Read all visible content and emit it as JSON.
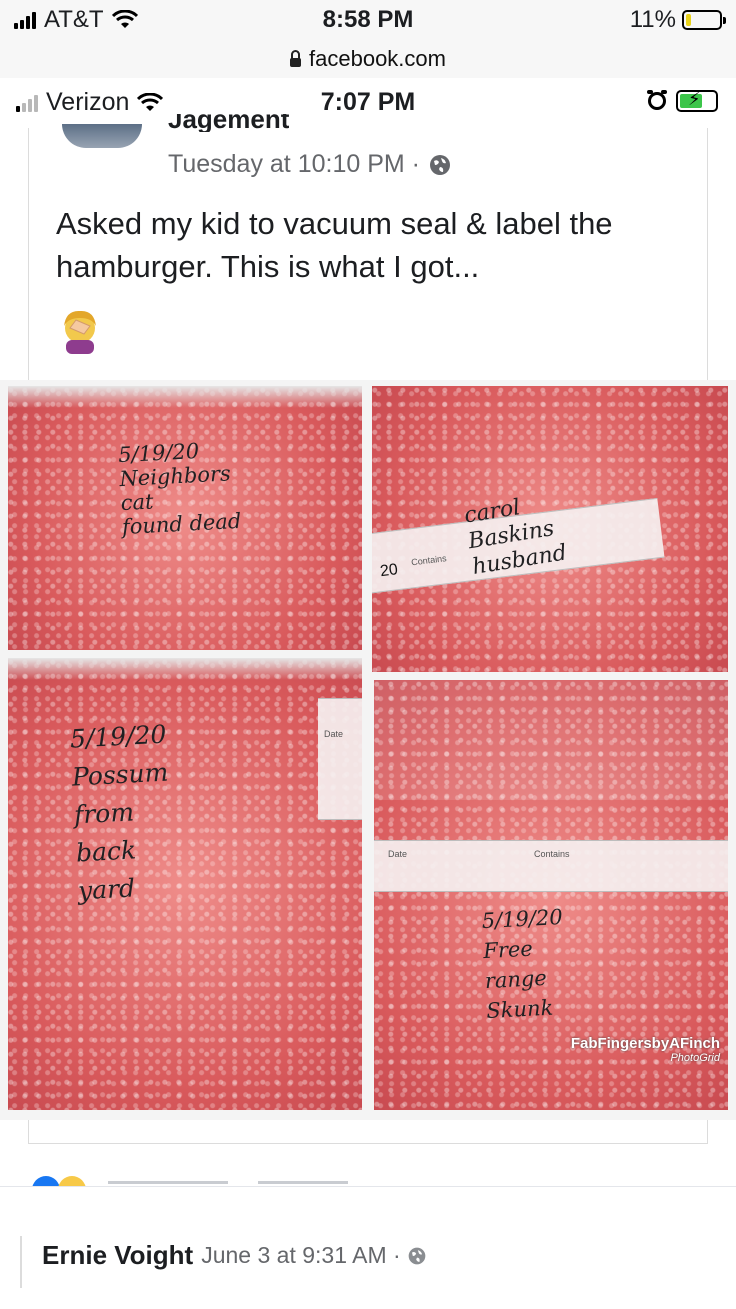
{
  "outer_status": {
    "carrier": "AT&T",
    "time": "8:58 PM",
    "battery_percent": "11%",
    "url": "facebook.com",
    "battery_level": 0.11
  },
  "inner_status": {
    "carrier": "Verizon",
    "time": "7:07 PM",
    "battery_level": 0.55,
    "battery_color": "#3cc54a"
  },
  "post": {
    "author_partial": "Jagement",
    "timestamp": "Tuesday at 10:10 PM ·",
    "privacy_icon": "globe-icon",
    "text": "Asked my kid to vacuum seal & label the hamburger. This is what I got...",
    "emoji": "face-palm-emoji",
    "photos": [
      {
        "label": "5/19/20\nNeighbors\ncat\nfound dead"
      },
      {
        "label": "carol\nBaskins\nhusband",
        "strip_text": "Contains",
        "strip_date": "20"
      },
      {
        "label": "5/19/20\nPossum\nfrom\nback\nyard",
        "strip_text": "Date"
      },
      {
        "label": "5/19/20\nFree\nrange\nSkunk",
        "strip_text": "Date",
        "strip_text2": "Contains"
      }
    ],
    "watermark": "FabFingersbyAFinch",
    "watermark_sub": "PhotoGrid"
  },
  "comment": {
    "author": "Ernie Voight",
    "timestamp": "June 3 at 9:31 AM ·",
    "privacy_icon": "globe-icon"
  },
  "colors": {
    "fb_grey_text": "#65676b",
    "meat_red": "#d95a5c"
  }
}
